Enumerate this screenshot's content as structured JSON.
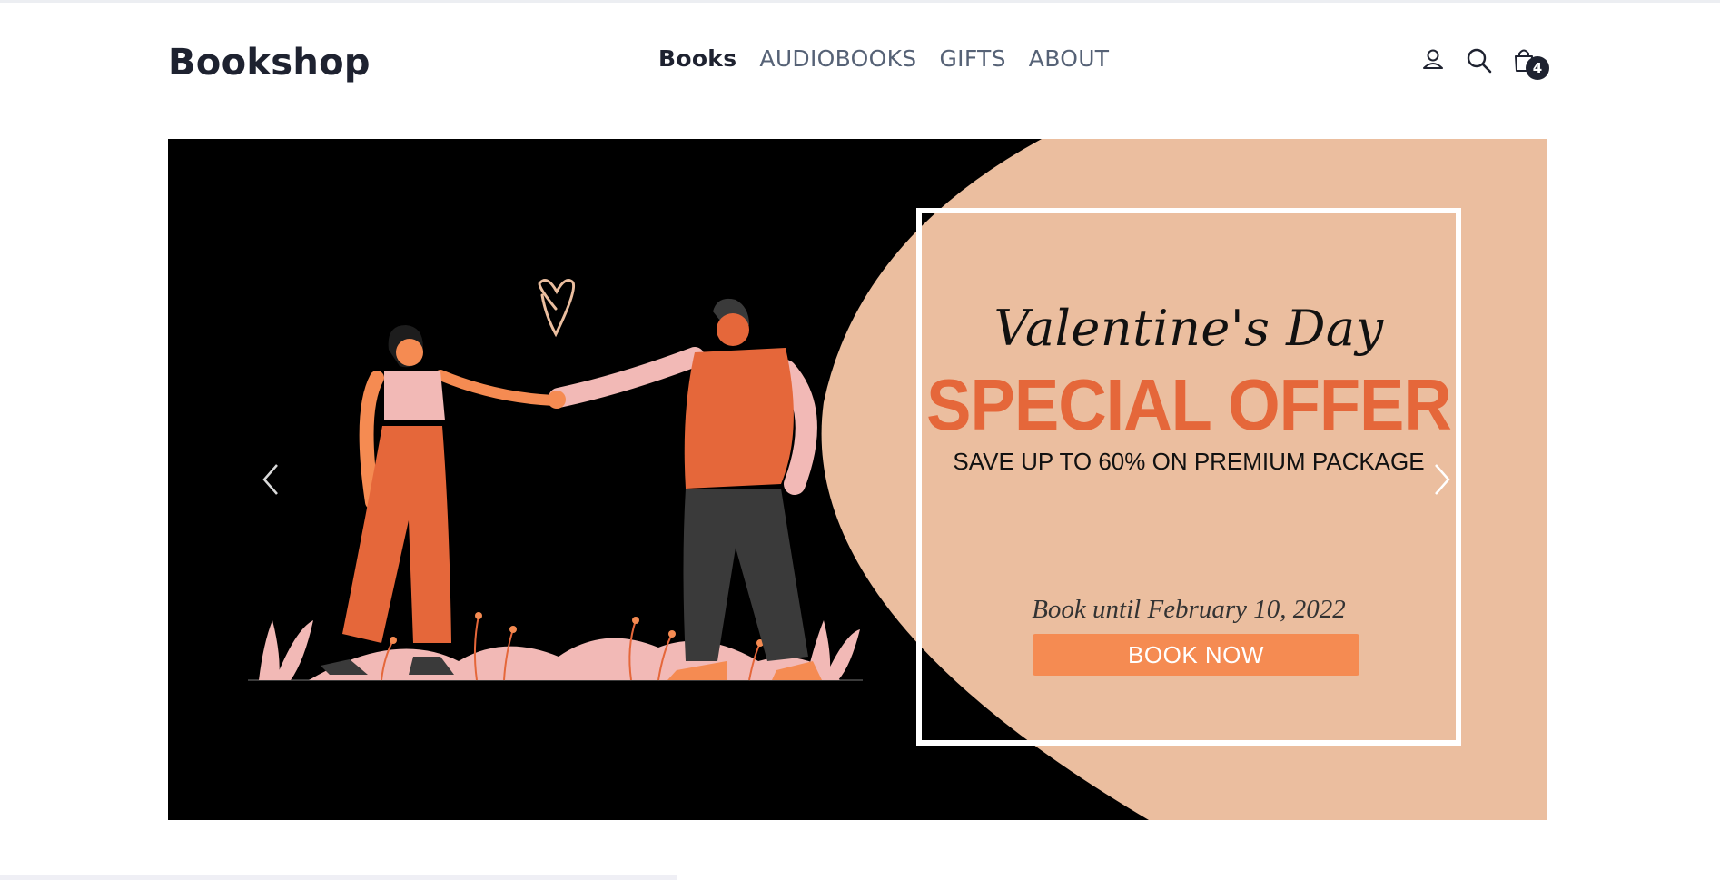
{
  "header": {
    "brand": "Bookshop",
    "nav": [
      {
        "label": "Books",
        "active": true
      },
      {
        "label": "AUDIOBOOKS",
        "active": false
      },
      {
        "label": "GIFTS",
        "active": false
      },
      {
        "label": "ABOUT",
        "active": false
      }
    ],
    "icons": [
      "user-icon",
      "search-icon",
      "shopping-bag-icon"
    ],
    "cart_count": "4"
  },
  "hero": {
    "script_title": "Valentine's Day",
    "title": "SPECIAL OFFER",
    "subtitle": "SAVE UP TO 60% ON PREMIUM PACKAGE",
    "date_text": "Book until February 10, 2022",
    "cta_label": "BOOK NOW",
    "prev_icon": "chevron-left-icon",
    "next_icon": "chevron-right-icon"
  },
  "colors": {
    "accent": "#e5673a",
    "button": "#f58b52",
    "peach": "#ebbe9f",
    "dark": "#1e2230"
  }
}
